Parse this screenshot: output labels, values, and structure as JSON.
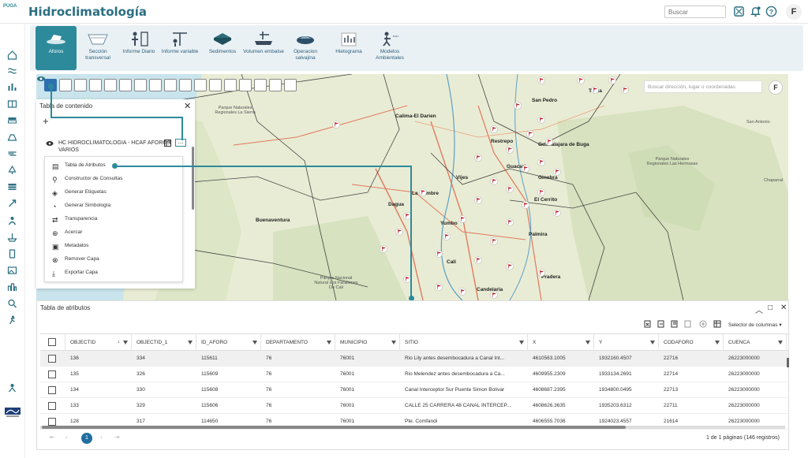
{
  "header": {
    "logo_text": "PUGA",
    "app_title": "Hidroclimatología",
    "search_placeholder": "Buscar",
    "avatar_letter": "F"
  },
  "ribbon": [
    {
      "label": "Aforos",
      "icon": "aforos-icon",
      "active": true
    },
    {
      "label": "Sección transversal",
      "icon": "cross-section-icon",
      "active": false
    },
    {
      "label": "Informe Diario",
      "icon": "daily-report-icon",
      "active": false
    },
    {
      "label": "Informe variable",
      "icon": "variable-report-icon",
      "active": false
    },
    {
      "label": "Sedimentos",
      "icon": "sediments-icon",
      "active": false
    },
    {
      "label": "Volumen embalse",
      "icon": "reservoir-volume-icon",
      "active": false
    },
    {
      "label": "Operacion salvajina",
      "icon": "salvajina-operation-icon",
      "active": false
    },
    {
      "label": "Hietograma",
      "icon": "hyetograph-icon",
      "active": false
    },
    {
      "label": "Modelos Ambientales",
      "icon": "environmental-models-icon",
      "active": false
    }
  ],
  "map": {
    "search_placeholder": "Buscar dirección, lugar o coordenadas",
    "user_letter": "F",
    "places": [
      {
        "name": "Tulua"
      },
      {
        "name": "Calima-El Darien"
      },
      {
        "name": "San Pedro"
      },
      {
        "name": "Restrepo"
      },
      {
        "name": "Guadalajara de Buga"
      },
      {
        "name": "Guacari"
      },
      {
        "name": "Vijes"
      },
      {
        "name": "Ginebra"
      },
      {
        "name": "La Cumbre"
      },
      {
        "name": "El Cerrito"
      },
      {
        "name": "Dagua"
      },
      {
        "name": "Buenaventura"
      },
      {
        "name": "Yumbo"
      },
      {
        "name": "Palmira"
      },
      {
        "name": "Cali"
      },
      {
        "name": "Pradera"
      },
      {
        "name": "Candelaria"
      },
      {
        "name": "Parque Nacional Natural Los Farallones De Cali"
      },
      {
        "name": "Parque Naturales Regionales Las Hermosas"
      },
      {
        "name": "Parque Naturales Regionales La Sierra"
      },
      {
        "name": "San Antonio"
      },
      {
        "name": "Chaparral"
      }
    ]
  },
  "toc": {
    "title": "Tabla de contenido",
    "layer_name": "HC HIDROCLIMATOLOGIA - HCAF AFOROS VARIOS",
    "more_label": "...",
    "menu": [
      {
        "label": "Tabla de Atributos",
        "icon": "table-icon"
      },
      {
        "label": "Constructor de Consultas",
        "icon": "query-builder-icon"
      },
      {
        "label": "Generar Etiquetas",
        "icon": "tag-icon"
      },
      {
        "label": "Generar Simbología",
        "icon": "symbology-icon"
      },
      {
        "label": "Transparencia",
        "icon": "transparency-icon"
      },
      {
        "label": "Acercar",
        "icon": "zoom-in-icon"
      },
      {
        "label": "Metadatos",
        "icon": "metadata-icon"
      },
      {
        "label": "Remover Capa",
        "icon": "remove-layer-icon"
      },
      {
        "label": "Exportar Capa",
        "icon": "export-icon"
      }
    ]
  },
  "attr_table": {
    "title": "Tabla de atributos",
    "column_selector": "Selector de columnas",
    "columns": [
      "OBJECTID",
      "OBJECTID_1",
      "ID_AFORO",
      "DEPARTAMENTO",
      "MUNICIPIO",
      "SITIO",
      "X",
      "Y",
      "CODAFORO",
      "CUENCA"
    ],
    "rows": [
      [
        "136",
        "334",
        "115611",
        "76",
        "76001",
        "Rio Lily antes desembocadura a Canal Int...",
        "4610563.1005",
        "1932160.4507",
        "22716",
        "26223000000"
      ],
      [
        "135",
        "326",
        "115609",
        "76",
        "76001",
        "Rio Melendez antes desembocadura a Ca...",
        "4609955.2309",
        "1933134.2691",
        "22714",
        "26223000000"
      ],
      [
        "134",
        "330",
        "115608",
        "76",
        "76001",
        "Canal Interceptor Sur Puente Simon Bolivar",
        "4608687.2395",
        "1934800.0495",
        "22713",
        "26223000000"
      ],
      [
        "133",
        "329",
        "115606",
        "76",
        "76001",
        "CALLE 25 CARRERA 48 CANAL INTERCEP...",
        "4608626.3635",
        "1935203.6312",
        "22711",
        "26223000000"
      ],
      [
        "128",
        "317",
        "114650",
        "76",
        "76001",
        "Pte. Comfandi",
        "4606555.7036",
        "1924023.4557",
        "21614",
        "26223000000"
      ]
    ],
    "current_page": "1",
    "page_info": "1 de 1 páginas (146 registros)"
  },
  "colors": {
    "accent": "#2d8a9b",
    "title": "#2b6f83",
    "active_tool": "#2d6fb0"
  }
}
